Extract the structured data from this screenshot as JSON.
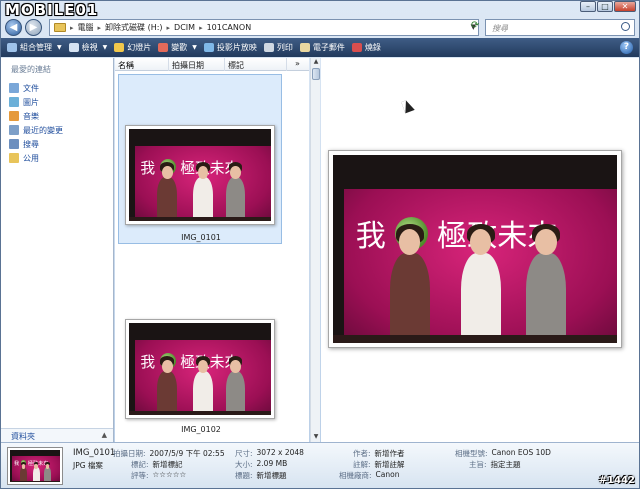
{
  "watermark": "MOBILE01",
  "window_buttons": {
    "minimize": "–",
    "maximize": "□",
    "close": "✕"
  },
  "address": {
    "crumbs": [
      "電腦",
      "卸除式磁碟 (H:)",
      "DCIM",
      "101CANON"
    ]
  },
  "search": {
    "placeholder": "搜尋"
  },
  "toolbar": {
    "items": [
      {
        "label": "組合管理",
        "has_menu": true,
        "icon_color": "#9fc3ea"
      },
      {
        "label": "檢視",
        "has_menu": true,
        "icon_color": "#d6e3f2"
      },
      {
        "label": "幻燈片",
        "has_menu": false,
        "icon_color": "#f2c84b"
      },
      {
        "label": "變歡",
        "has_menu": true,
        "icon_color": "#e36a5a"
      },
      {
        "label": "投影片放映",
        "has_menu": false,
        "icon_color": "#7fb8e8"
      },
      {
        "label": "列印",
        "has_menu": false,
        "icon_color": "#cfd8e2"
      },
      {
        "label": "電子郵件",
        "has_menu": false,
        "icon_color": "#e9d7a0"
      },
      {
        "label": "燒錄",
        "has_menu": false,
        "icon_color": "#d84e4e"
      }
    ]
  },
  "nav_pane": {
    "heading": "最愛的連結",
    "items": [
      {
        "label": "文件",
        "icon_color": "#7aa7d8"
      },
      {
        "label": "圖片",
        "icon_color": "#6cb0d8"
      },
      {
        "label": "音樂",
        "icon_color": "#e59a3c"
      },
      {
        "label": "最近的變更",
        "icon_color": "#7d9fc8"
      },
      {
        "label": "搜尋",
        "icon_color": "#6c8fbf"
      },
      {
        "label": "公用",
        "icon_color": "#e8c45a"
      }
    ],
    "folders_label": "資料夾"
  },
  "file_list": {
    "columns": [
      "名稱",
      "拍攝日期",
      "標記"
    ],
    "more": "»",
    "files": [
      {
        "name": "IMG_0101",
        "selected": true
      },
      {
        "name": "IMG_0102",
        "selected": false
      }
    ]
  },
  "photo": {
    "slogan_left": "我",
    "slogan_right": "極致未來"
  },
  "details": {
    "name": "IMG_0101",
    "type": "JPG 檔案",
    "fields": {
      "date_taken": {
        "label": "拍攝日期:",
        "value": "2007/5/9 下午 02:55"
      },
      "tags": {
        "label": "標記:",
        "value": "新增標記"
      },
      "rating": {
        "label": "評等:",
        "value": 0,
        "max": 5
      },
      "dimensions": {
        "label": "尺寸:",
        "value": "3072 x 2048"
      },
      "size": {
        "label": "大小:",
        "value": "2.09 MB"
      },
      "title": {
        "label": "標題:",
        "value": "新增標題"
      },
      "authors": {
        "label": "作者:",
        "value": "新增作者"
      },
      "comments": {
        "label": "註解:",
        "value": "新增註解"
      },
      "camera_maker": {
        "label": "相機廠商:",
        "value": "Canon"
      },
      "camera_model": {
        "label": "相機型號:",
        "value": "Canon EOS 10D"
      },
      "subject": {
        "label": "主旨:",
        "value": "指定主題"
      }
    }
  },
  "corner_tag": "#1442",
  "colors": {
    "accent": "#1f4d9c",
    "toolbar": "#2f4b72",
    "stage": "#c81c6e"
  }
}
